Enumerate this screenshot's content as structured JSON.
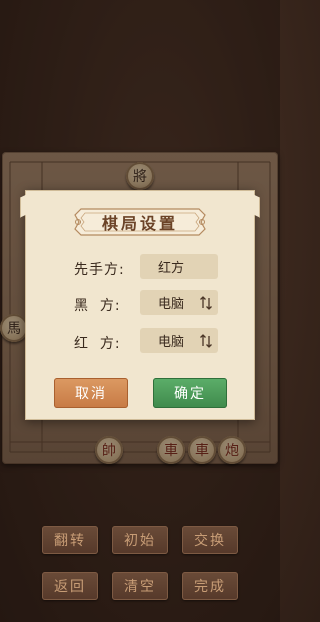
{
  "board": {
    "pieces": [
      {
        "id": "general-black",
        "label": "將",
        "side": "black"
      },
      {
        "id": "horse-black-left",
        "label": "馬",
        "side": "black"
      },
      {
        "id": "general-red",
        "label": "帥",
        "side": "red"
      },
      {
        "id": "chariot-red-1",
        "label": "車",
        "side": "red"
      },
      {
        "id": "chariot-red-2",
        "label": "車",
        "side": "red"
      },
      {
        "id": "cannon-red",
        "label": "炮",
        "side": "red"
      }
    ]
  },
  "dialog": {
    "title": "棋局设置",
    "first_move_label": "先手方:",
    "first_move_value": "红方",
    "black_label": "黑  方:",
    "black_value": "电脑",
    "red_label": "红  方:",
    "red_value": "电脑",
    "cancel_label": "取消",
    "confirm_label": "确定",
    "swap_icon": "swap-arrows-icon"
  },
  "controls": {
    "flip": "翻转",
    "initial": "初始",
    "swap": "交换",
    "back": "返回",
    "clear": "清空",
    "done": "完成"
  },
  "colors": {
    "cancel": "#d08a55",
    "confirm": "#4c9c5a",
    "dialog_bg": "#f1e6cf",
    "title": "#6b4327"
  }
}
